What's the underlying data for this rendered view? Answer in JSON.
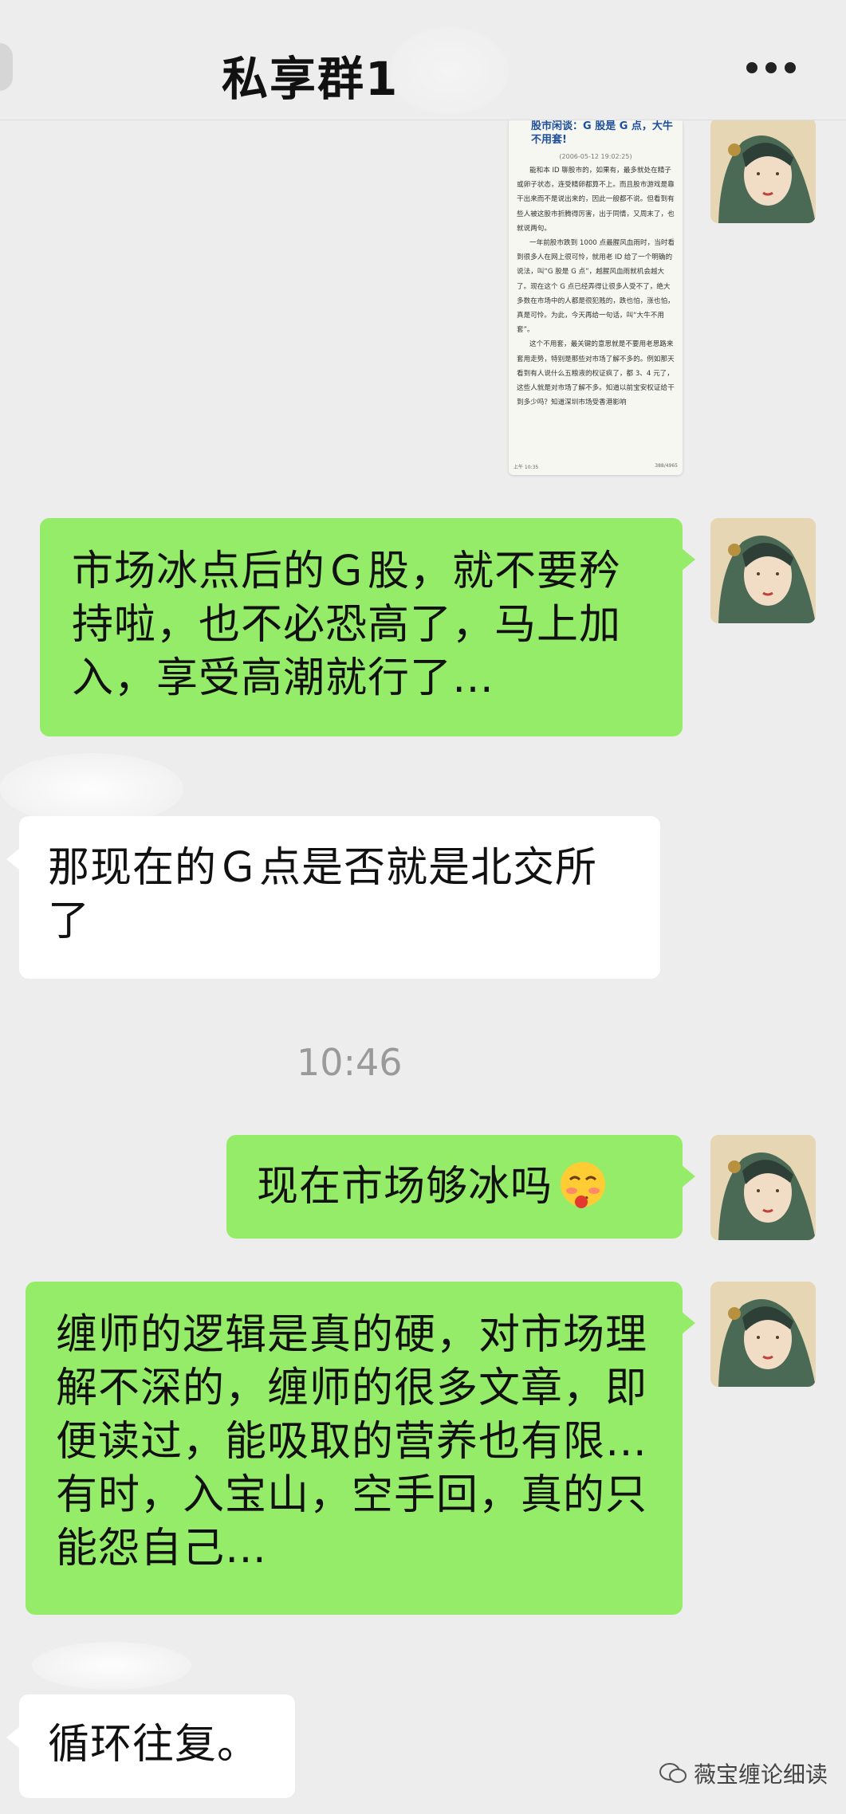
{
  "header": {
    "title": "私享群1"
  },
  "doc_image": {
    "title": "股市闲谈：G 股是 G 点，大牛不用套!",
    "date": "(2006-05-12 19:02:25)",
    "paragraphs": [
      "能和本 ID 聊股市的，如果有，最多就处在精子或卵子状态，连受精卵都算不上。而且股市游戏是靠干出来而不是说出来的，因此一般都不说。但看到有些人被这股市折腾得厉害，出于同情，又周末了，也就说两句。",
      "一年前股市跌到 1000 点最腥风血雨时，当时看到很多人在网上很可怜，就用老 ID 给了一个明确的说法，叫“G 股是 G 点”，越腥风血雨就机会越大了。现在这个 G 点已经弄得让很多人受不了，绝大多数在市场中的人都是很犯贱的，跌也怕，涨也怕，真是可怜。为此，今天再给一句话，叫“大牛不用套”。",
      "这个不用套，最关键的意思就是不要用老思路来套用走势，特别是那些对市场了解不多的。例如那天看到有人说什么五粮液的权证疯了，都 3、4 元了，这些人就是对市场了解不多。知道以前宝安权证给干到多少吗？知道深圳市场受香港影响"
    ],
    "footer_left": "上午 10:35",
    "footer_right": "388/4965"
  },
  "messages": {
    "m1": "市场冰点后的Ｇ股，就不要矜持啦，也不必恐高了，马上加入，享受高潮就行了…",
    "m2": "那现在的Ｇ点是否就是北交所了",
    "time": "10:46",
    "m3": "现在市场够冰吗",
    "m4": "缠师的逻辑是真的硬，对市场理解不深的，缠师的很多文章，即便读过，能吸取的营养也有限…有时，入宝山，空手回，真的只能怨自己…",
    "m5": "循环往复。"
  },
  "watermark": {
    "text": "薇宝缠论细读"
  },
  "colors": {
    "sent": "#95ec69",
    "received": "#ffffff",
    "background": "#ededed"
  }
}
